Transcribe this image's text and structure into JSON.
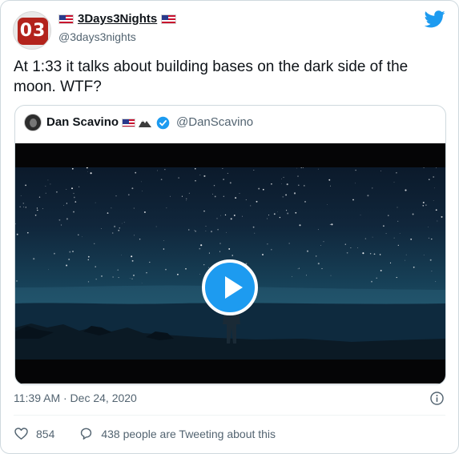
{
  "author": {
    "display_name": "3Days3Nights",
    "handle": "@3days3nights",
    "avatar_text": "03"
  },
  "tweet": {
    "text": "At 1:33 it talks about building bases on the dark side of the moon. WTF?",
    "timestamp": "11:39 AM · Dec 24, 2020",
    "likes": "854",
    "conversation_text": "438 people are Tweeting about this"
  },
  "quoted": {
    "display_name": "Dan Scavino",
    "handle": "@DanScavino",
    "verified": true
  },
  "media": {
    "type": "video",
    "state": "paused"
  },
  "icons": {
    "brand": "twitter-bird-icon",
    "info": "info-icon",
    "like": "heart-icon",
    "reply": "speech-bubble-icon",
    "play": "play-icon"
  },
  "colors": {
    "accent": "#1d9bf0",
    "secondary_text": "#536471",
    "border": "#cfd9de"
  }
}
